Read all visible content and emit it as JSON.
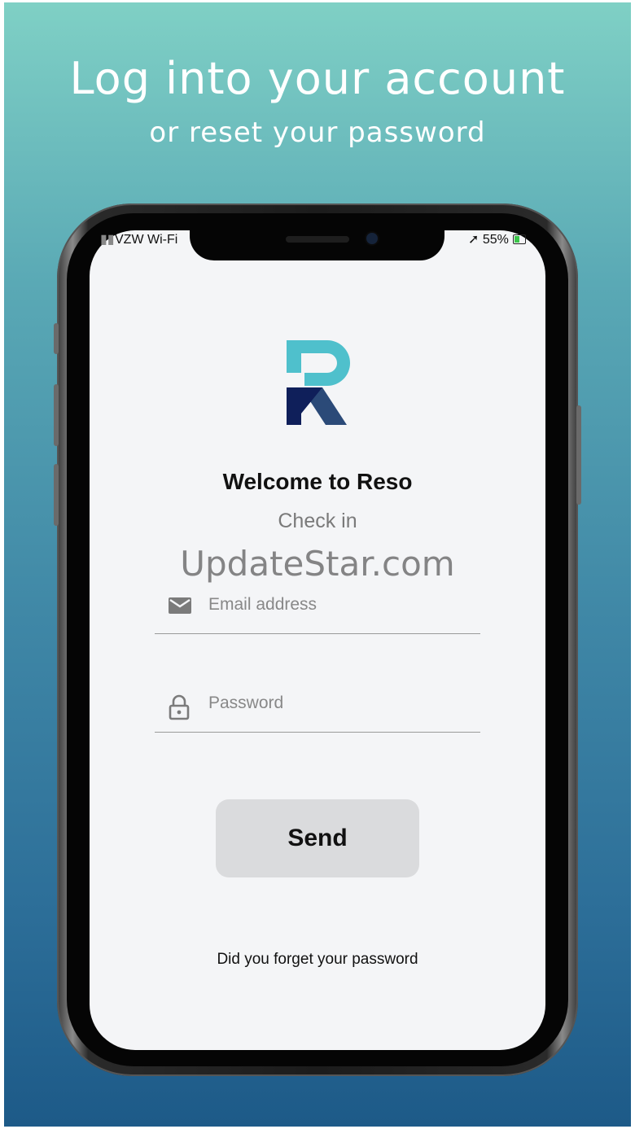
{
  "promo": {
    "headline": "Log into your account",
    "subline": "or reset your password"
  },
  "status_bar": {
    "carrier": "VZW Wi-Fi",
    "battery": "55%",
    "location_icon": "location-arrow-icon"
  },
  "app": {
    "brand_colors": {
      "teal": "#4fc0cc",
      "navy_light": "#2b4a78",
      "navy_dark": "#0f1f5a"
    },
    "welcome": "Welcome to Reso",
    "subtitle": "Check in",
    "watermark": "UpdateStar.com",
    "email": {
      "placeholder": "Email address",
      "value": "",
      "icon": "mail-icon"
    },
    "password": {
      "placeholder": "Password",
      "value": "",
      "icon": "lock-icon"
    },
    "send_label": "Send",
    "forgot_label": "Did you forget your password"
  }
}
